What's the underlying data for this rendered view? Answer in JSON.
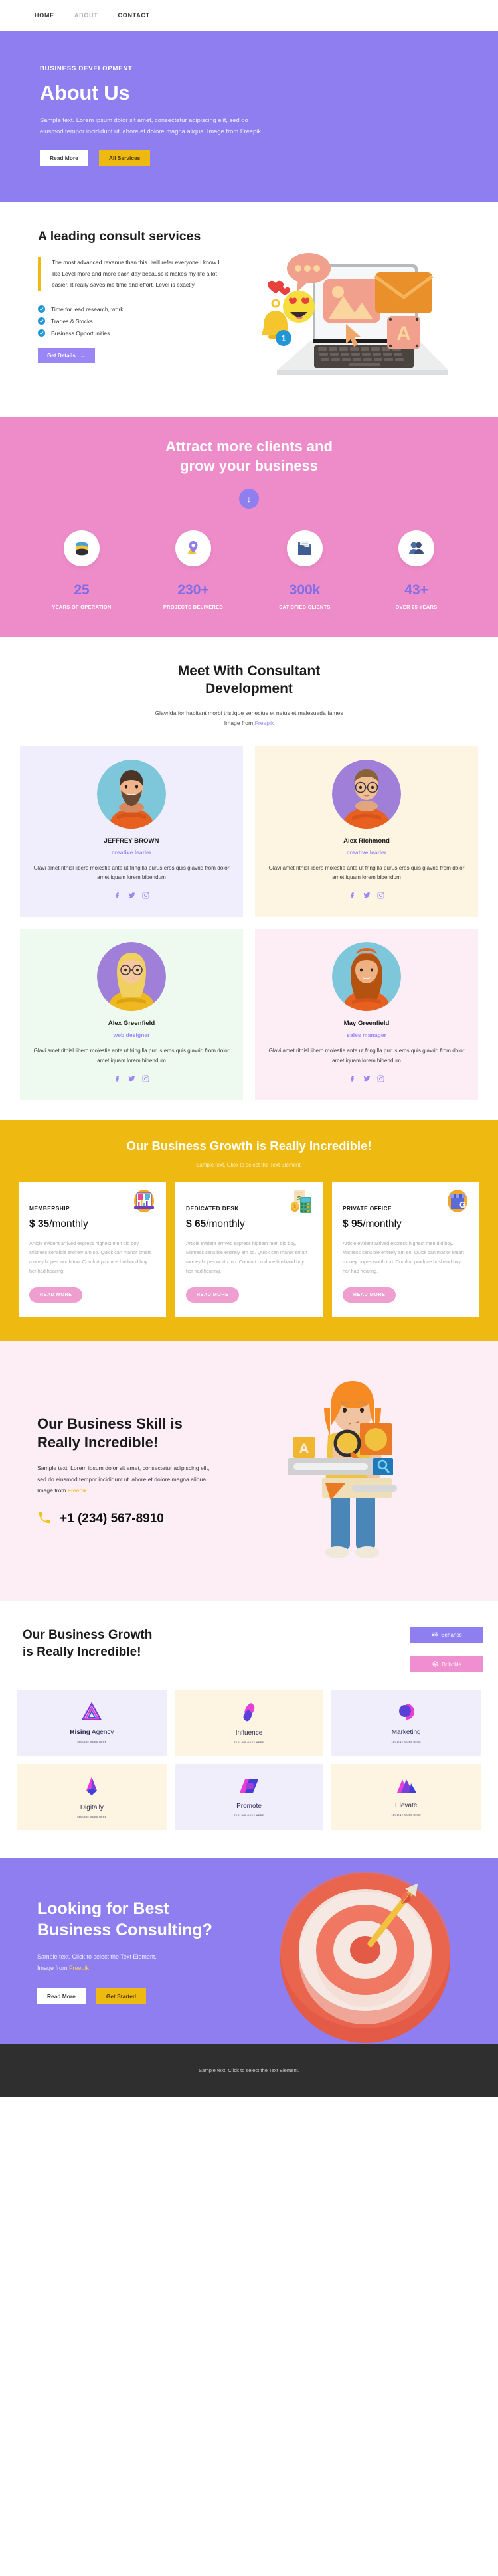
{
  "nav": {
    "items": [
      {
        "label": "HOME",
        "active": true
      },
      {
        "label": "ABOUT",
        "active": false
      },
      {
        "label": "CONTACT",
        "active": true
      }
    ]
  },
  "hero": {
    "eyebrow": "BUSINESS DEVELOPMENT",
    "title": "About Us",
    "body": "Sample text. Lorem ipsum dolor sit amet, consectetur adipiscing elit, sed do eiusmod tempor incididunt ut labore et dolore magna aliqua. Image from Freepik",
    "btn_primary": "Read More",
    "btn_secondary": "All Services",
    "bg_color": "#8f7ef0"
  },
  "consult": {
    "title": "A leading consult services",
    "quote": "The most advanced revenue than this. Iwill refer everyone I know I like Level more and more each day because it makes my life a lot easier. It really saves me time and effort. Level is exactly",
    "checks": [
      "Time for lead research, work",
      "Trades & Stocks",
      "Business Opportunities"
    ],
    "cta": "Get Details",
    "accent_color": "#eeb911"
  },
  "stats": {
    "title_line1": "Attract more clients and",
    "title_line2": "grow your business",
    "bg_color": "#ee8cc9",
    "number_color": "#7e6ce8",
    "items": [
      {
        "icon": "database-icon",
        "value": "25",
        "label": "YEARS OF OPERATION"
      },
      {
        "icon": "location-pin-icon",
        "value": "230+",
        "label": "PROJECTS DELIVERED"
      },
      {
        "icon": "folder-icon",
        "value": "300k",
        "label": "SATISFIED CLIENTS"
      },
      {
        "icon": "users-icon",
        "value": "43+",
        "label": "OVER 25 YEARS"
      }
    ]
  },
  "team": {
    "title_line1": "Meet With Consultant",
    "title_line2": "Development",
    "subtitle": "Glavrida for habitant morbi tristique senectus et netus et malesuada fames",
    "credit_prefix": "Image from ",
    "credit_link": "Freepik",
    "desc": "Glavi amet ritnisl libero molestie ante ut fringilla purus eros quis glavrid from dolor amet iquam lorem bibendum",
    "members": [
      {
        "name": "JEFFREY BROWN",
        "role": "creative leader"
      },
      {
        "name": "Alex Richmond",
        "role": "creative leader"
      },
      {
        "name": "Alex Greenfield",
        "role": "web designer"
      },
      {
        "name": "May Greenfield",
        "role": "sales manager"
      }
    ]
  },
  "pricing": {
    "title": "Our Business Growth is Really Incredible!",
    "subtitle": "Sample text. Click to select the Text Element.",
    "bg_color": "#eeb911",
    "desc": "Article evident arrived express highest men did boy. Mistress sensible entirely am so. Quick can manor smart money hopes worth too. Comfort produce husband boy her had hearing.",
    "button_label": "READ MORE",
    "plans": [
      {
        "name": "MEMBERSHIP",
        "currency": "$",
        "amount": "35",
        "period": "/monthly",
        "icon": "laptop-chart-icon"
      },
      {
        "name": "DEDICATED DESK",
        "currency": "$",
        "amount": "65",
        "period": "/monthly",
        "icon": "calculator-icon"
      },
      {
        "name": "PRIVATE OFFICE",
        "currency": "$",
        "amount": "95",
        "period": "/monthly",
        "icon": "storefront-icon"
      }
    ]
  },
  "skill": {
    "title_line1": "Our Business Skill is",
    "title_line2": "Really Incredible!",
    "body_prefix": "Sample text. Lorem ipsum dolor sit amet, consectetur adipiscing elit, sed do eiusmod tempor incididunt ut labore et dolore magna aliqua. Image from ",
    "body_link": "Freepik",
    "phone": "+1 (234) 567-8910",
    "bg_color": "#fdeef6"
  },
  "logos": {
    "title_line1": "Our Business Growth",
    "title_line2": "is Really Incredible!",
    "buttons": [
      {
        "label": "Behance",
        "icon": "behance-icon",
        "color": "#8f7ef0"
      },
      {
        "label": "Dribbble",
        "icon": "dribbble-icon",
        "color": "#ef8fd0"
      }
    ],
    "tagline": "TAGLINE GOES HERE",
    "items": [
      {
        "name_bold": "Rising",
        "name_rest": " Agency",
        "mark": "triangle-mark"
      },
      {
        "name_bold": "",
        "name_rest": "Influence",
        "mark": "comma-mark"
      },
      {
        "name_bold": "",
        "name_rest": "Marketing",
        "mark": "circle-mark"
      },
      {
        "name_bold": "",
        "name_rest": "Digitally",
        "mark": "arrow-mark"
      },
      {
        "name_bold": "",
        "name_rest": "Promote",
        "mark": "parallelogram-mark"
      },
      {
        "name_bold": "",
        "name_rest": "Elevate",
        "mark": "chevron-mark"
      }
    ]
  },
  "cta": {
    "title_line1": "Looking for Best",
    "title_line2": "Business Consulting?",
    "body_line1": "Sample text. Click to select the Text Element.",
    "body_prefix": "Image from ",
    "body_link": "Freepik",
    "btn_primary": "Read More",
    "btn_secondary": "Get Started",
    "bg_color": "#8f7ef0"
  },
  "footer": {
    "text": "Sample text. Click to select the Text Element.",
    "bg_color": "#2f2f2f"
  }
}
